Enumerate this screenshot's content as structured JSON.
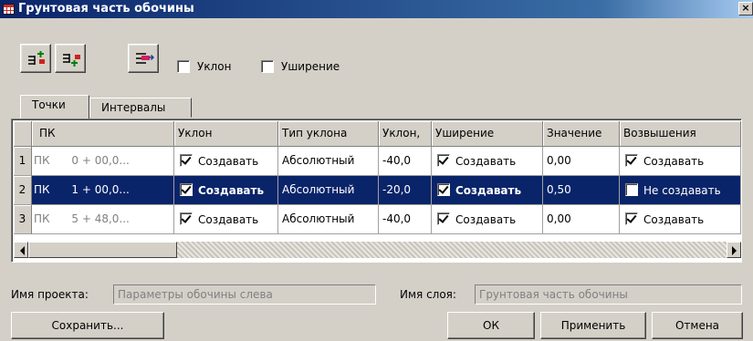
{
  "window": {
    "title": "Грунтовая часть обочины",
    "close_glyph": "×"
  },
  "toolbar": {
    "slope_label": "Уклон",
    "slope_checked": false,
    "widening_label": "Уширение",
    "widening_checked": false
  },
  "tabs": [
    "Точки",
    "Интервалы"
  ],
  "table": {
    "headers": [
      "ПК",
      "Уклон",
      "Тип уклона",
      "Уклон,",
      "Уширение",
      "Значение",
      "Возвышения"
    ],
    "rows": [
      {
        "num": "1",
        "pk": "ПК",
        "station": "0 + 00,0...",
        "slope": "Создавать",
        "slope_checked": true,
        "slope_type": "Абсолютный",
        "slope_value": "-40,0",
        "widening": "Создавать",
        "widening_checked": true,
        "value": "0,00",
        "elevation": "Создавать",
        "elevation_checked": true
      },
      {
        "num": "2",
        "pk": "ПК",
        "station": "1 + 00,0...",
        "slope": "Создавать",
        "slope_checked": true,
        "slope_type": "Абсолютный",
        "slope_value": "-20,0",
        "widening": "Создавать",
        "widening_checked": true,
        "value": "0,50",
        "elevation": "Не создавать",
        "elevation_checked": false
      },
      {
        "num": "3",
        "pk": "ПК",
        "station": "5 + 48,0...",
        "slope": "Создавать",
        "slope_checked": true,
        "slope_type": "Абсолютный",
        "slope_value": "-40,0",
        "widening": "Создавать",
        "widening_checked": true,
        "value": "0,00",
        "elevation": "Создавать",
        "elevation_checked": true
      }
    ]
  },
  "footer": {
    "project_label": "Имя проекта:",
    "project_value": "Параметры обочины слева",
    "layer_label": "Имя слоя:",
    "layer_value": "Грунтовая часть обочины",
    "save_label": "Сохранить...",
    "ok_label": "ОК",
    "apply_label": "Применить",
    "cancel_label": "Отмена"
  },
  "colors": {
    "selection": "#0a246a",
    "face": "#d4d0c8"
  }
}
